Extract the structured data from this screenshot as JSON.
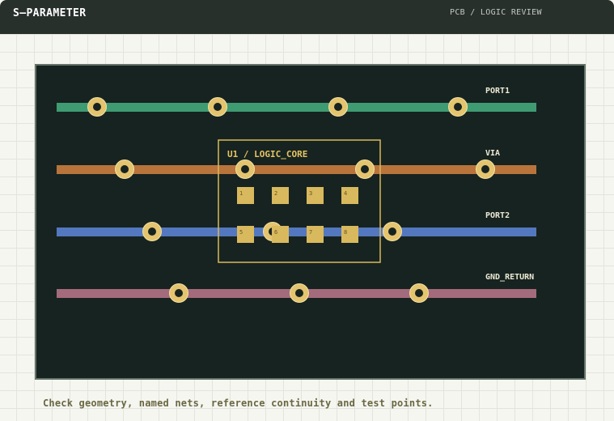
{
  "header": {
    "title": "S–PARAMETER",
    "breadcrumb": "PCB / LOGIC REVIEW"
  },
  "nets": [
    {
      "label": "PORT1",
      "color": "#3f9b72",
      "vias": 4
    },
    {
      "label": "VIA",
      "color": "#b8743b",
      "vias": 4
    },
    {
      "label": "PORT2",
      "color": "#5478bf",
      "vias": 3
    },
    {
      "label": "GND_RETURN",
      "color": "#a36b7c",
      "vias": 3
    }
  ],
  "component": {
    "label": "U1 / LOGIC_CORE",
    "pins": [
      "1",
      "2",
      "3",
      "4",
      "5",
      "6",
      "7",
      "8"
    ]
  },
  "colors": {
    "via_ring": "#e4c46e",
    "via_hole": "#172320",
    "pad": "#d9b95e",
    "outline": "#d9b95e"
  },
  "footer": {
    "note": "Check geometry, named nets, reference continuity and test points."
  }
}
